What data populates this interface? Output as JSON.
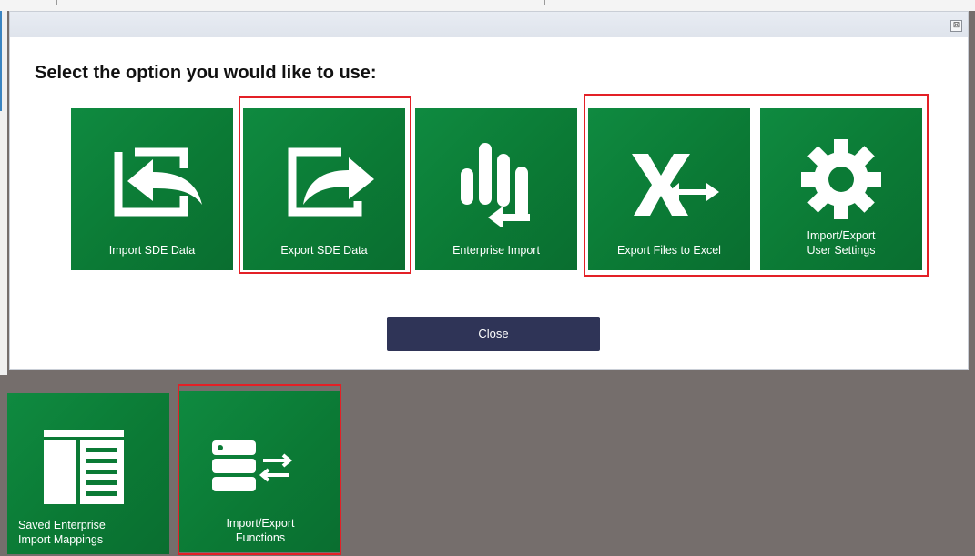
{
  "dialog": {
    "prompt": "Select the option you would like to use:",
    "close_glyph": "⊠",
    "close_button": "Close",
    "tiles": [
      {
        "label": "Import SDE Data",
        "icon": "import-arrow-icon",
        "highlighted": false
      },
      {
        "label": "Export SDE Data",
        "icon": "export-arrow-icon",
        "highlighted": true
      },
      {
        "label": "Enterprise Import",
        "icon": "enterprise-import-icon",
        "highlighted": false
      },
      {
        "label": "Export Files to Excel",
        "icon": "excel-export-icon",
        "highlighted": true
      },
      {
        "label": "Import/Export\nUser Settings",
        "icon": "gear-icon",
        "highlighted": true
      }
    ]
  },
  "background_tiles": [
    {
      "label": "Saved Enterprise\nImport Mappings",
      "icon": "document-list-icon",
      "highlighted": false
    },
    {
      "label": "Import/Export\nFunctions",
      "icon": "database-transfer-icon",
      "highlighted": true
    }
  ],
  "colors": {
    "tile_green": "#0b7a35",
    "highlight_red": "#e32026",
    "close_button_bg": "#2f3457",
    "backdrop": "#756e6c"
  }
}
